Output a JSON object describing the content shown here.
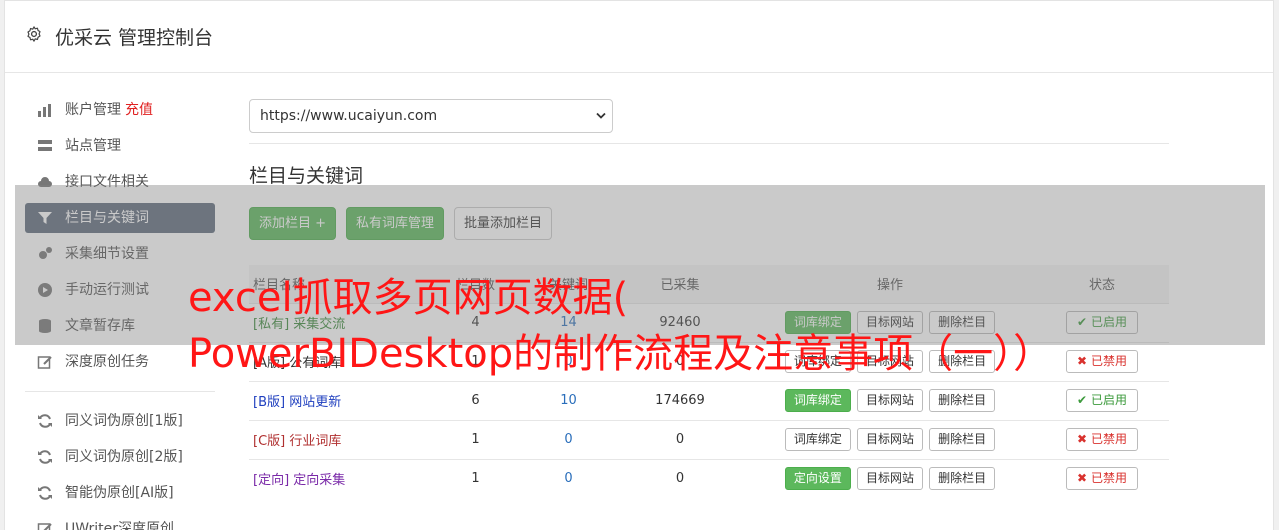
{
  "header": {
    "title": "优采云 管理控制台",
    "icon": "gear-icon"
  },
  "sidebar": {
    "items": [
      {
        "label": "账户管理",
        "extra": "充值",
        "icon": "bar-chart-icon"
      },
      {
        "label": "站点管理",
        "icon": "server-icon"
      },
      {
        "label": "接口文件相关",
        "icon": "cloud-upload-icon"
      },
      {
        "label": "栏目与关键词",
        "icon": "filter-icon",
        "active": true
      },
      {
        "label": "采集细节设置",
        "icon": "cogs-icon"
      },
      {
        "label": "手动运行测试",
        "icon": "play-circle-icon"
      },
      {
        "label": "文章暂存库",
        "icon": "database-icon"
      },
      {
        "label": "深度原创任务",
        "icon": "edit-icon"
      },
      {
        "label": "同义词伪原创[1版]",
        "icon": "refresh-icon"
      },
      {
        "label": "同义词伪原创[2版]",
        "icon": "refresh-icon"
      },
      {
        "label": "智能伪原创[AI版]",
        "icon": "refresh-icon"
      },
      {
        "label": "UWriter深度原创",
        "icon": "edit-icon"
      }
    ]
  },
  "main": {
    "site_select": {
      "value": "https://www.ucaiyun.com"
    },
    "section_title": "栏目与关键词",
    "buttons": {
      "add": "添加栏目 +",
      "private_lib": "私有词库管理",
      "batch_add": "批量添加栏目"
    },
    "table": {
      "headers": {
        "name": "栏目名称",
        "count": "栏目数",
        "keywords": "关键词",
        "collected": "已采集",
        "ops": "操作",
        "status": "状态"
      },
      "rows": [
        {
          "tag": "[私有]",
          "name": "采集交流",
          "count": "4",
          "keywords": "14",
          "collected": "92460",
          "op1": "词库绑定",
          "op1_green": true,
          "op2": "目标网站",
          "op3": "删除栏目",
          "status": "已启用",
          "status_on": true,
          "color": "#3c8a3c"
        },
        {
          "tag": "[A版]",
          "name": "公有词库",
          "count": "1",
          "keywords": "0",
          "collected": "0",
          "op1": "词库绑定",
          "op1_green": false,
          "op2": "目标网站",
          "op3": "删除栏目",
          "status": "已禁用",
          "status_on": false,
          "color": "#333333"
        },
        {
          "tag": "[B版]",
          "name": "网站更新",
          "count": "6",
          "keywords": "10",
          "collected": "174669",
          "op1": "词库绑定",
          "op1_green": true,
          "op2": "目标网站",
          "op3": "删除栏目",
          "status": "已启用",
          "status_on": true,
          "color": "#1f3fbf"
        },
        {
          "tag": "[C版]",
          "name": "行业词库",
          "count": "1",
          "keywords": "0",
          "collected": "0",
          "op1": "词库绑定",
          "op1_green": false,
          "op2": "目标网站",
          "op3": "删除栏目",
          "status": "已禁用",
          "status_on": false,
          "color": "#b03030"
        },
        {
          "tag": "[定向]",
          "name": "定向采集",
          "count": "1",
          "keywords": "0",
          "collected": "0",
          "op1": "定向设置",
          "op1_green": true,
          "op2": "目标网站",
          "op3": "删除栏目",
          "status": "已禁用",
          "status_on": false,
          "color": "#7a2aa8"
        }
      ]
    }
  },
  "overlay": {
    "line1": "excel抓取多页网页数据(",
    "line2": "PowerBIDesktop的制作流程及注意事项（一））"
  }
}
